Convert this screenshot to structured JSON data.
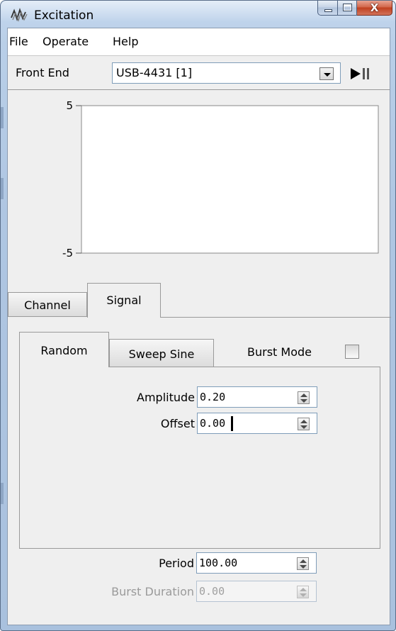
{
  "window": {
    "title": "Excitation",
    "close_glyph": "X",
    "min_icon": "minimize-icon",
    "max_icon": "maximize-icon",
    "app_icon": "waveform-icon"
  },
  "menu": {
    "items": [
      "File",
      "Operate",
      "Help"
    ]
  },
  "toolbar": {
    "front_end_label": "Front End",
    "front_end_value": "USB-4431 [1]",
    "run_icon": "play-pause-icon"
  },
  "chart_data": {
    "type": "line",
    "tick_labels": [
      "5",
      "-5"
    ],
    "ylim": [
      -5,
      5
    ],
    "series": []
  },
  "tabs": {
    "outer": [
      "Channel",
      "Signal"
    ],
    "outer_selected": "Signal",
    "inner": [
      "Random",
      "Sweep Sine"
    ],
    "inner_selected": "Random"
  },
  "burst_mode": {
    "label": "Burst Mode",
    "checked": false
  },
  "fields": {
    "amplitude": {
      "label": "Amplitude",
      "value": "0.20"
    },
    "offset": {
      "label": "Offset",
      "value": "0.00"
    },
    "period": {
      "label": "Period",
      "value": "100.00"
    },
    "burst_duration": {
      "label": "Burst Duration",
      "value": "0.00",
      "enabled": false
    }
  },
  "colors": {
    "frame": "#b9cfe8",
    "client_bg": "#efefef",
    "close_button": "#c0401f",
    "input_border": "#7f9db9"
  }
}
